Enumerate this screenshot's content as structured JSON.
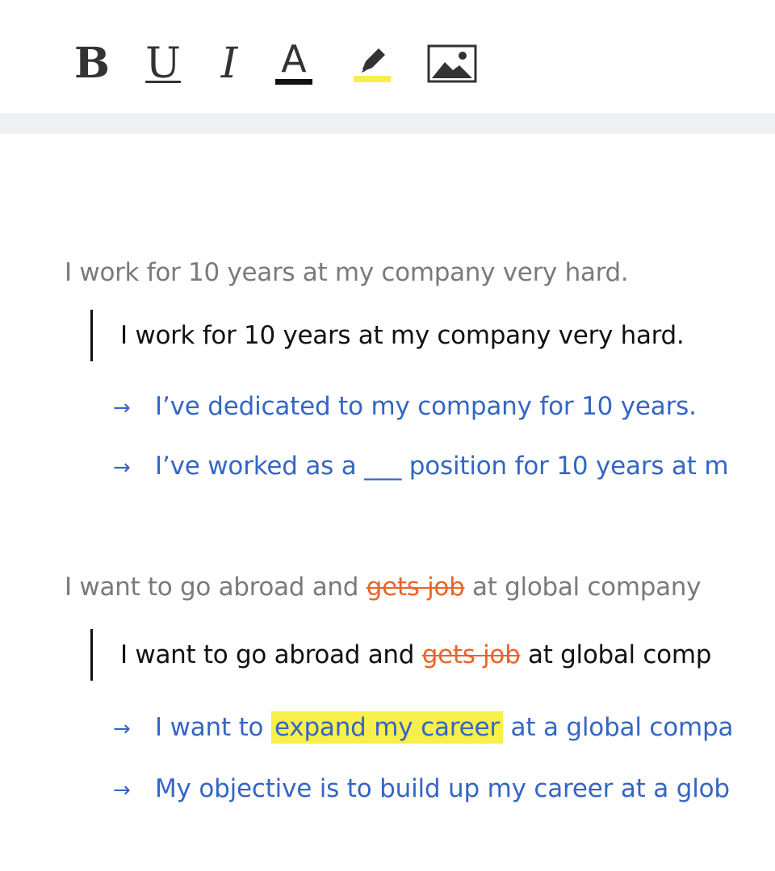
{
  "toolbar": {
    "bold_label": "B",
    "underline_label": "U",
    "italic_label": "I",
    "text_color_label": "A",
    "text_color_bar": "#111111",
    "highlight_bar": "#f7ef4a"
  },
  "entries": [
    {
      "original": "I work for 10 years at my company very hard.",
      "quoted": "I work for 10 years at my company very hard.",
      "suggestions": [
        "I’ve dedicated to my company for 10 years.",
        "I’ve worked as a ___ position for 10 years at m"
      ]
    },
    {
      "original_before": "I want to go abroad and ",
      "original_strike": "gets job",
      "original_after": " at global company",
      "quoted_before": "I want to go abroad and ",
      "quoted_strike": "gets job",
      "quoted_after": " at global comp",
      "suggestions": [
        {
          "before": "I want to ",
          "highlight": "expand my career",
          "after": " at a global compa"
        },
        "My objective is to build up my career at a glob"
      ]
    }
  ],
  "arrow_glyph": "→",
  "colors": {
    "suggestion": "#3466c4",
    "strike": "#e8652b",
    "highlight": "#f7ef4a",
    "original": "#7a7a7a"
  }
}
